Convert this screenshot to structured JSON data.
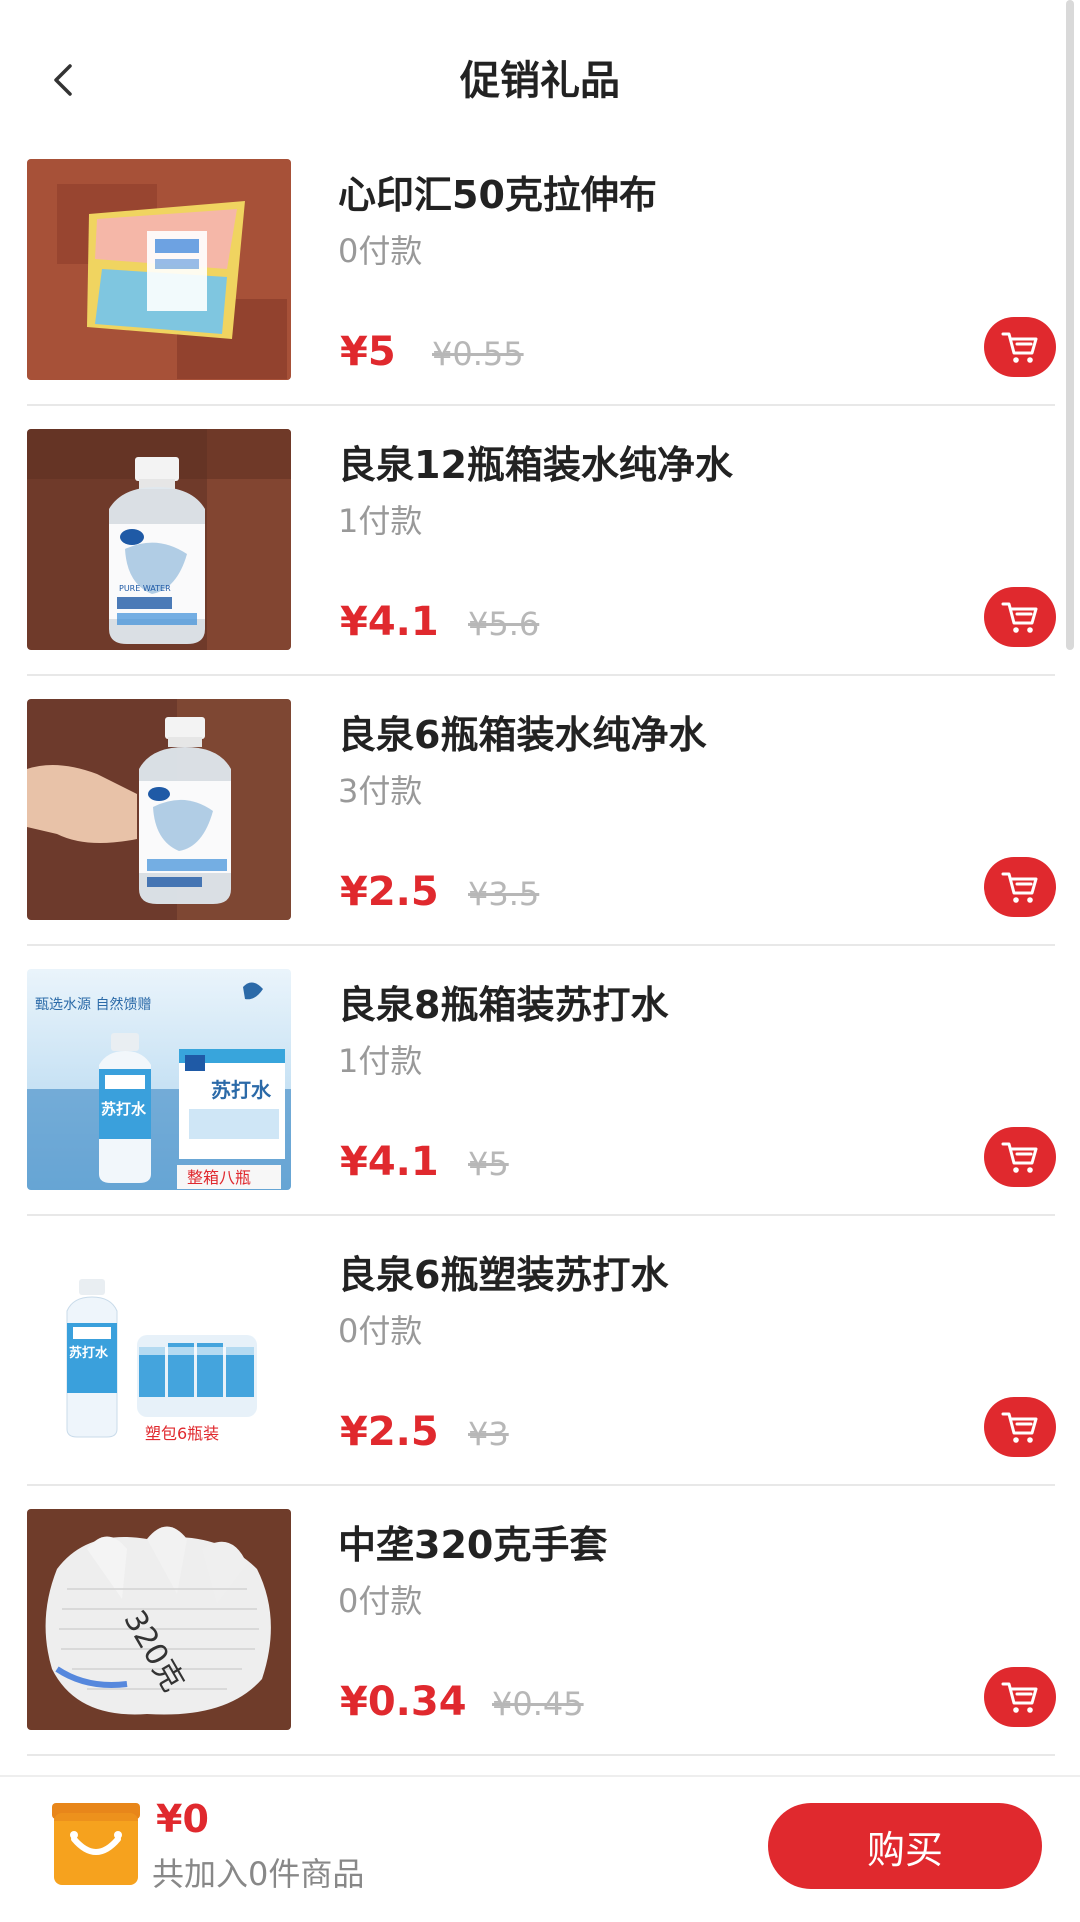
{
  "header": {
    "title": "促销礼品",
    "back_icon": "chevron-left-icon"
  },
  "products": [
    {
      "name": "心印汇50克拉伸布",
      "sales": "0付款",
      "price": "¥5",
      "original_price": "¥0.55"
    },
    {
      "name": "良泉12瓶箱装水纯净水",
      "sales": "1付款",
      "price": "¥4.1",
      "original_price": "¥5.6"
    },
    {
      "name": "良泉6瓶箱装水纯净水",
      "sales": "3付款",
      "price": "¥2.5",
      "original_price": "¥3.5"
    },
    {
      "name": "良泉8瓶箱装苏打水",
      "sales": "1付款",
      "price": "¥4.1",
      "original_price": "¥5"
    },
    {
      "name": "良泉6瓶塑装苏打水",
      "sales": "0付款",
      "price": "¥2.5",
      "original_price": "¥3"
    },
    {
      "name": "中垄320克手套",
      "sales": "0付款",
      "price": "¥0.34",
      "original_price": "¥0.45"
    }
  ],
  "image_text": {
    "soda_box_slogan": "甄选水源  自然馈赠",
    "soda_label": "苏打水",
    "soda_box_caption": "整箱八瓶",
    "soda_pack_caption": "塑包6瓶装",
    "water_label": "PURE WATER",
    "glove_mark": "320克"
  },
  "footer": {
    "total": "¥0",
    "count_text": "共加入0件商品",
    "buy_label": "购买",
    "cart_icon": "shopping-bag-icon"
  },
  "colors": {
    "accent": "#e0292e",
    "bag": "#f6a21e"
  }
}
